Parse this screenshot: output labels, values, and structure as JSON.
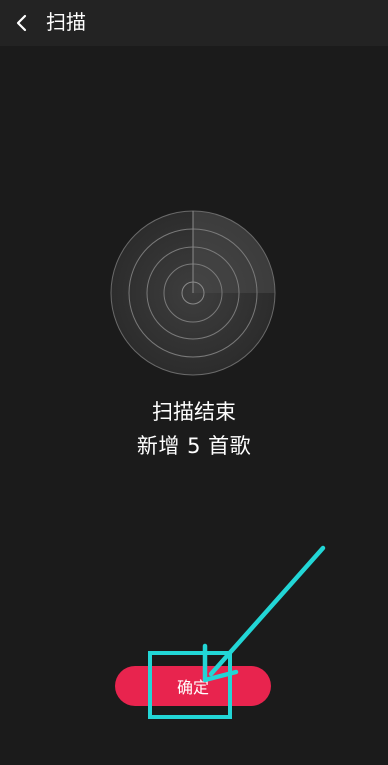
{
  "header": {
    "back_icon": "chevron-left-icon",
    "title": "扫描"
  },
  "radar": {
    "icon": "radar-icon"
  },
  "result": {
    "status": "扫描结束",
    "summary": "新增 5 首歌"
  },
  "actions": {
    "confirm_label": "确定"
  },
  "colors": {
    "background": "#1b1b1b",
    "header": "#232323",
    "accent": "#e8244e",
    "annotation": "#22d6d6"
  }
}
